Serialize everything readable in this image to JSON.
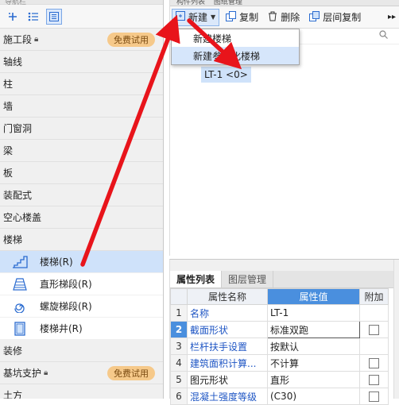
{
  "left": {
    "title": "导航栏",
    "toolbar": [
      "add-icon",
      "list-view-icon",
      "detail-view-icon"
    ],
    "items": [
      {
        "label": "施工段",
        "locked": true,
        "badge": "免费试用"
      },
      {
        "label": "轴线"
      },
      {
        "label": "柱"
      },
      {
        "label": "墙"
      },
      {
        "label": "门窗洞"
      },
      {
        "label": "梁"
      },
      {
        "label": "板"
      },
      {
        "label": "装配式"
      },
      {
        "label": "空心楼盖"
      },
      {
        "label": "楼梯"
      }
    ],
    "stair_children": [
      {
        "label": "楼梯(R)",
        "icon": "stair-icon",
        "selected": true
      },
      {
        "label": "直形梯段(R)",
        "icon": "straight-flight-icon"
      },
      {
        "label": "螺旋梯段(R)",
        "icon": "spiral-flight-icon"
      },
      {
        "label": "楼梯井(R)",
        "icon": "stairwell-icon"
      }
    ],
    "after": [
      {
        "label": "装修"
      },
      {
        "label": "基坑支护",
        "locked": true,
        "badge": "免费试用"
      },
      {
        "label": "土方"
      }
    ]
  },
  "component_panel": {
    "tabs": [
      "构件列表",
      "图纸管理"
    ],
    "toolbar": {
      "new_label": "新建",
      "copy_label": "复制",
      "delete_label": "删除",
      "floor_copy_label": "层间复制"
    },
    "dropdown": [
      "新建楼梯",
      "新建参数化楼梯"
    ],
    "tree_node": "LT-1 <0>"
  },
  "properties": {
    "tabs": [
      "属性列表",
      "图层管理"
    ],
    "headers": {
      "name": "属性名称",
      "value": "属性值",
      "extra": "附加"
    },
    "rows": [
      {
        "num": "1",
        "name": "名称",
        "value": "LT-1",
        "blue": true,
        "check": false
      },
      {
        "num": "2",
        "name": "截面形状",
        "value": "标准双跑",
        "blue": true,
        "check": true,
        "selected": true
      },
      {
        "num": "3",
        "name": "栏杆扶手设置",
        "value": "按默认",
        "blue": true,
        "check": false
      },
      {
        "num": "4",
        "name": "建筑面积计算...",
        "value": "不计算",
        "blue": true,
        "check": true
      },
      {
        "num": "5",
        "name": "图元形状",
        "value": "直形",
        "blue": false,
        "check": true
      },
      {
        "num": "6",
        "name": "混凝土强度等级",
        "value": "(C30)",
        "blue": true,
        "check": true
      }
    ]
  },
  "colors": {
    "accent": "#4a8fde",
    "badge": "#f6c98a",
    "arrow": "#e8141b"
  }
}
